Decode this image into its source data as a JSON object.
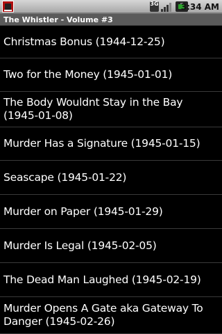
{
  "status_bar": {
    "network": "3G",
    "time": "3:34 AM",
    "icons": [
      "app-notification-icon",
      "3g-network-icon",
      "signal-icon",
      "battery-icon"
    ]
  },
  "title_bar": {
    "title": "The Whistler - Volume #3"
  },
  "episodes": [
    {
      "label": "Christmas Bonus (1944-12-25)"
    },
    {
      "label": "Two for the Money (1945-01-01)"
    },
    {
      "label": "The Body Wouldnt Stay in the Bay (1945-01-08)"
    },
    {
      "label": "Murder Has a Signature (1945-01-15)"
    },
    {
      "label": "Seascape (1945-01-22)"
    },
    {
      "label": "Murder on Paper (1945-01-29)"
    },
    {
      "label": "Murder Is Legal (1945-02-05)"
    },
    {
      "label": "The Dead Man Laughed (1945-02-19)"
    },
    {
      "label": "Murder Opens A Gate aka Gateway To Danger (1945-02-26)"
    }
  ]
}
